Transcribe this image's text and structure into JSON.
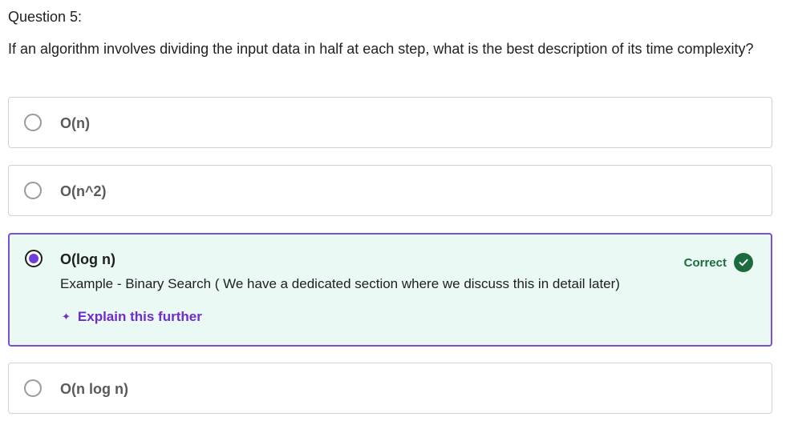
{
  "question": {
    "label": "Question 5:",
    "text": "If an algorithm involves dividing the input data in half at each step, what is the best description of its time complexity?"
  },
  "options": [
    {
      "label": "O(n)",
      "selected": false
    },
    {
      "label": "O(n^2)",
      "selected": false
    },
    {
      "label": "O(log n)",
      "selected": true,
      "status": "Correct",
      "explanation": "Example - Binary Search ( We have a dedicated section where we discuss this in detail later)",
      "explain_link": "Explain this further"
    },
    {
      "label": "O(n log n)",
      "selected": false
    }
  ],
  "colors": {
    "selected_border": "#7b4fd6",
    "selected_background": "#eaf9f4",
    "correct_text": "#1b6b3e",
    "link": "#6f2bd0"
  },
  "icons": {
    "correct": "check-circle-icon",
    "explain": "sparkle-icon"
  }
}
